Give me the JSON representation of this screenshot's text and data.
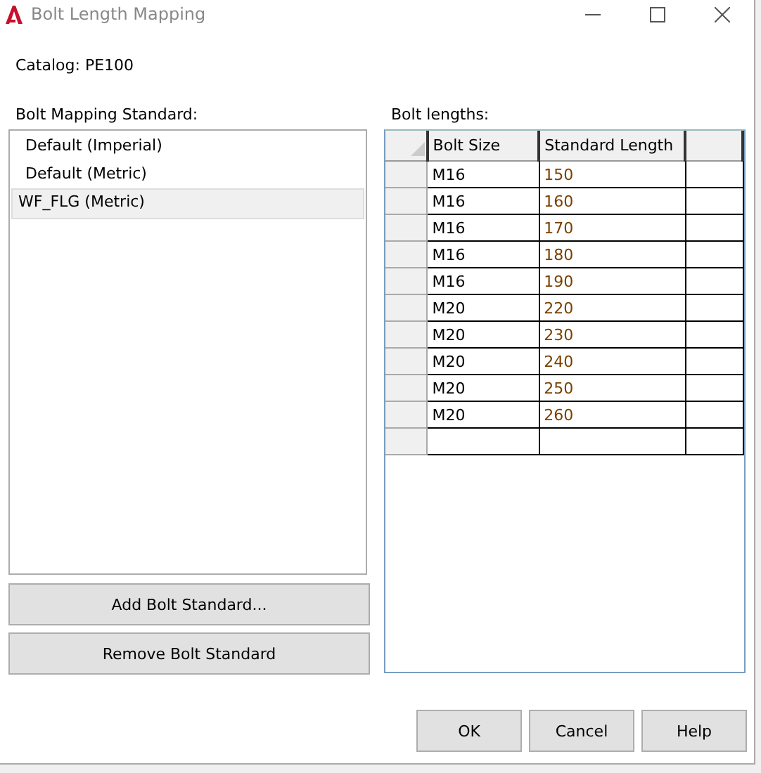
{
  "window": {
    "title": "Bolt Length Mapping"
  },
  "catalog": "Catalog: PE100",
  "standards": {
    "label": "Bolt Mapping Standard:",
    "items": [
      {
        "label": "Default (Imperial)",
        "selected": false
      },
      {
        "label": "Default (Metric)",
        "selected": false
      },
      {
        "label": "WF_FLG (Metric)",
        "selected": true
      }
    ]
  },
  "side_buttons": [
    "Add Bolt Standard...",
    "Remove Bolt Standard"
  ],
  "lengths": {
    "label": "Bolt lengths:",
    "columns": [
      "Bolt Size",
      "Standard Length"
    ],
    "rows": [
      [
        "M16",
        "150"
      ],
      [
        "M16",
        "160"
      ],
      [
        "M16",
        "170"
      ],
      [
        "M16",
        "180"
      ],
      [
        "M16",
        "190"
      ],
      [
        "M20",
        "220"
      ],
      [
        "M20",
        "230"
      ],
      [
        "M20",
        "240"
      ],
      [
        "M20",
        "250"
      ],
      [
        "M20",
        "260"
      ]
    ]
  },
  "buttons": [
    "OK",
    "Cancel",
    "Help"
  ]
}
